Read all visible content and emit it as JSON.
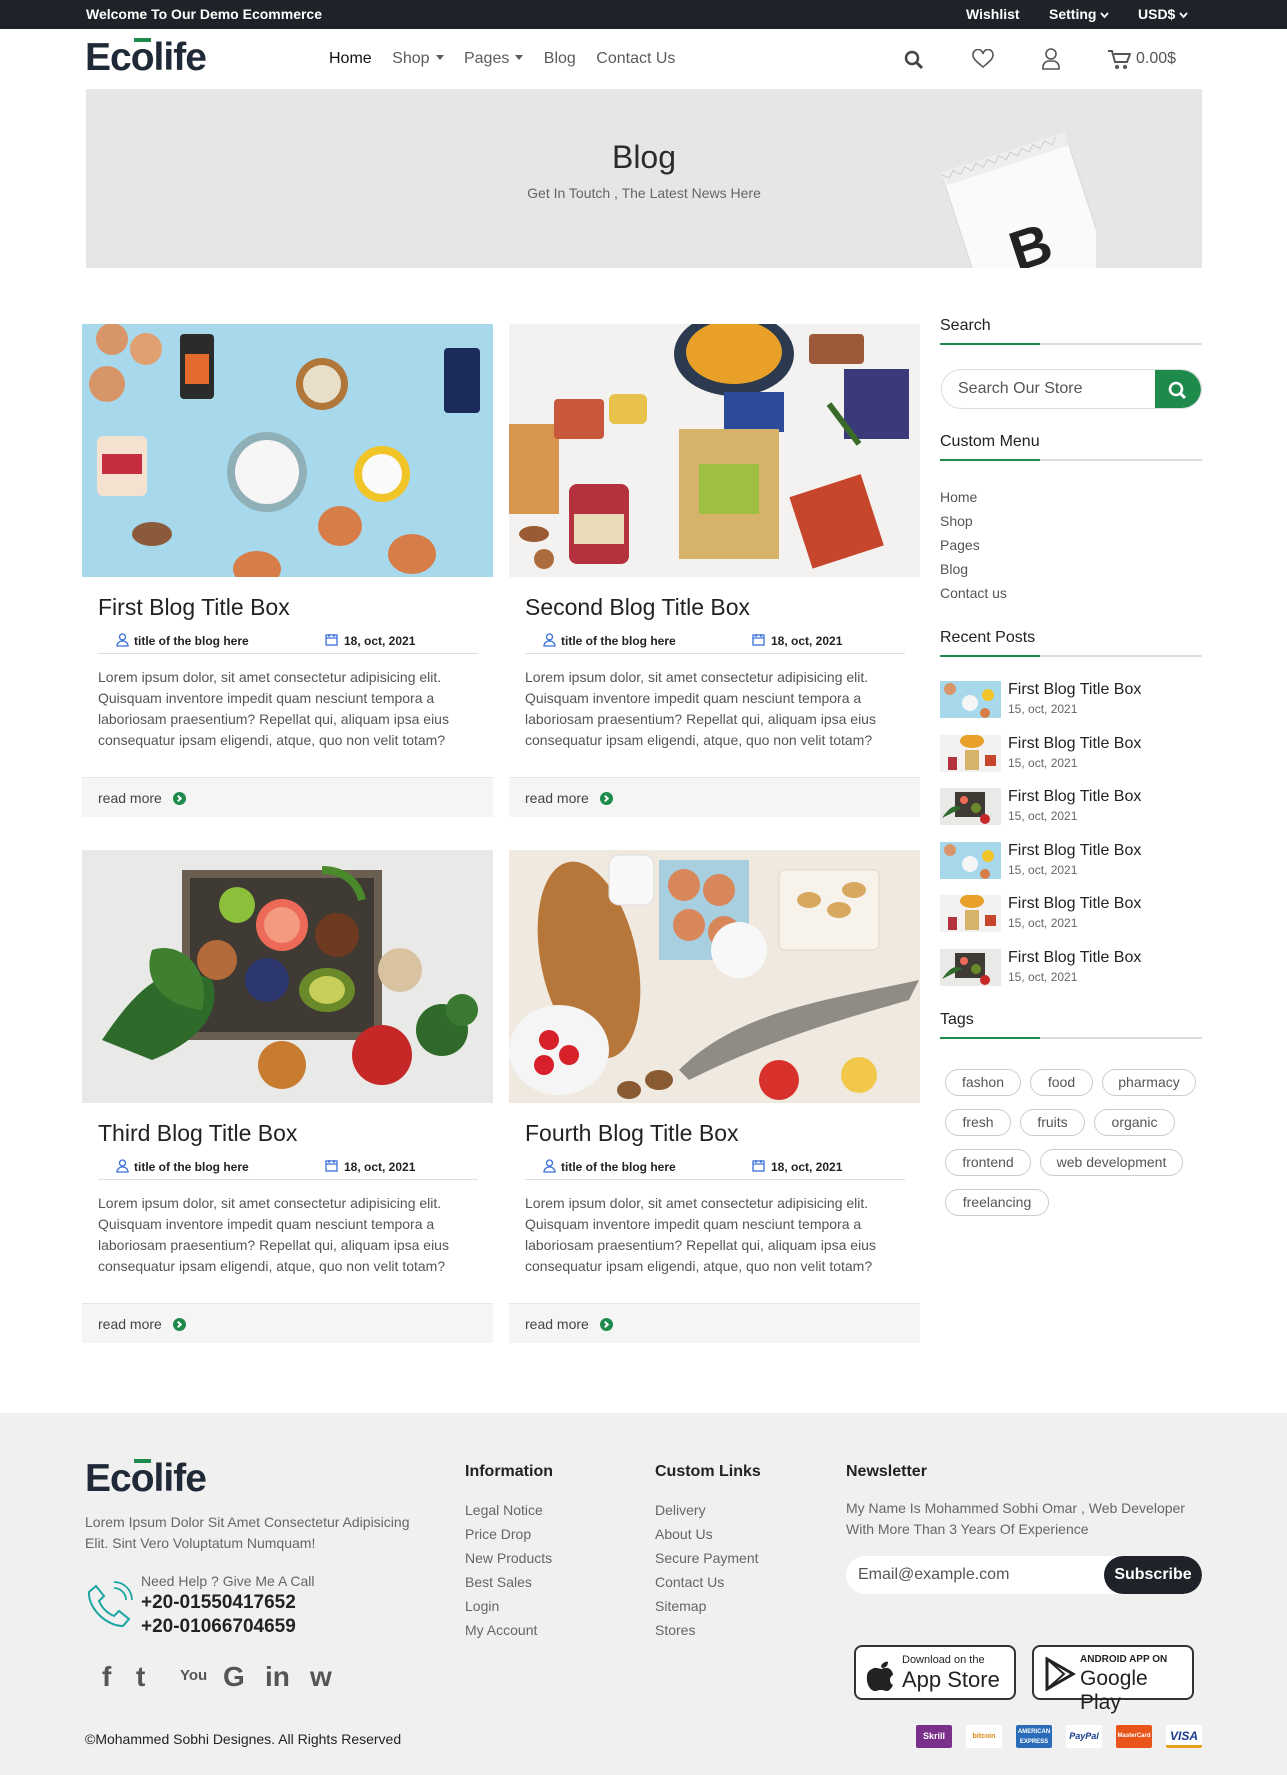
{
  "topbar": {
    "welcome": "Welcome To Our Demo Ecommerce",
    "wishlist": "Wishlist",
    "setting": "Setting",
    "currency": "USD$"
  },
  "header": {
    "logo": {
      "pre": "Ec",
      "o": "o",
      "post": "life"
    },
    "menu": [
      {
        "label": "Home",
        "active": true
      },
      {
        "label": "Shop",
        "caret": true
      },
      {
        "label": "Pages",
        "caret": true
      },
      {
        "label": "Blog"
      },
      {
        "label": "Contact Us"
      }
    ],
    "cart_total": "0.00$"
  },
  "banner": {
    "title": "Blog",
    "subtitle": "Get In Toutch , The Latest News Here"
  },
  "posts": [
    {
      "title": "First Blog Title Box",
      "author": "title of the blog here",
      "date": "18, oct, 2021",
      "excerpt": "Lorem ipsum dolor, sit amet consectetur adipisicing elit. Quisquam inventore impedit quam nesciunt tempora a laboriosam praesentium? Repellat qui, aliquam ipsa eius consequatur ipsam eligendi, atque, quo non velit totam?",
      "read_more": "read more"
    },
    {
      "title": "Second Blog Title Box",
      "author": "title of the blog here",
      "date": "18, oct, 2021",
      "excerpt": "Lorem ipsum dolor, sit amet consectetur adipisicing elit. Quisquam inventore impedit quam nesciunt tempora a laboriosam praesentium? Repellat qui, aliquam ipsa eius consequatur ipsam eligendi, atque, quo non velit totam?",
      "read_more": "read more"
    },
    {
      "title": "Third Blog Title Box",
      "author": "title of the blog here",
      "date": "18, oct, 2021",
      "excerpt": "Lorem ipsum dolor, sit amet consectetur adipisicing elit. Quisquam inventore impedit quam nesciunt tempora a laboriosam praesentium? Repellat qui, aliquam ipsa eius consequatur ipsam eligendi, atque, quo non velit totam?",
      "read_more": "read more"
    },
    {
      "title": "Fourth Blog Title Box",
      "author": "title of the blog here",
      "date": "18, oct, 2021",
      "excerpt": "Lorem ipsum dolor, sit amet consectetur adipisicing elit. Quisquam inventore impedit quam nesciunt tempora a laboriosam praesentium? Repellat qui, aliquam ipsa eius consequatur ipsam eligendi, atque, quo non velit totam?",
      "read_more": "read more"
    }
  ],
  "sidebar": {
    "search": {
      "heading": "Search",
      "placeholder": "Search Our Store"
    },
    "custom_menu": {
      "heading": "Custom Menu",
      "items": [
        "Home",
        "Shop",
        "Pages",
        "Blog",
        "Contact us"
      ]
    },
    "recent_posts": {
      "heading": "Recent Posts",
      "items": [
        {
          "title": "First Blog Title Box",
          "date": "15, oct, 2021"
        },
        {
          "title": "First Blog Title Box",
          "date": "15, oct, 2021"
        },
        {
          "title": "First Blog Title Box",
          "date": "15, oct, 2021"
        },
        {
          "title": "First Blog Title Box",
          "date": "15, oct, 2021"
        },
        {
          "title": "First Blog Title Box",
          "date": "15, oct, 2021"
        },
        {
          "title": "First Blog Title Box",
          "date": "15, oct, 2021"
        }
      ]
    },
    "tags": {
      "heading": "Tags",
      "items": [
        "fashon",
        "food",
        "pharmacy",
        "fresh",
        "fruits",
        "organic",
        "frontend",
        "web development",
        "freelancing"
      ]
    }
  },
  "footer": {
    "about": "Lorem Ipsum Dolor Sit Amet Consectetur Adipisicing Elit. Sint Vero Voluptatum Numquam!",
    "help_label": "Need Help ? Give Me A Call",
    "phones": [
      "+20-01550417652",
      "+20-01066704659"
    ],
    "social_icons": [
      "facebook-icon",
      "twitter-icon",
      "youtube-icon",
      "google-icon",
      "linkedin-icon",
      "whatsapp-icon"
    ],
    "social_glyphs": [
      "f",
      "t",
      "You",
      "G",
      "in",
      "w"
    ],
    "information": {
      "heading": "Information",
      "items": [
        "Legal Notice",
        "Price Drop",
        "New Products",
        "Best Sales",
        "Login",
        "My Account"
      ]
    },
    "custom_links": {
      "heading": "Custom Links",
      "items": [
        "Delivery",
        "About Us",
        "Secure Payment",
        "Contact Us",
        "Sitemap",
        "Stores"
      ]
    },
    "newsletter": {
      "heading": "Newsletter",
      "text": "My Name Is Mohammed Sobhi Omar , Web Developer With More Than 3 Years Of Experience",
      "placeholder": "Email@example.com",
      "button": "Subscribe"
    },
    "app_store": {
      "small": "Download on the",
      "big": "App Store"
    },
    "google_play": {
      "small": "ANDROID APP ON",
      "big": "Google Play"
    },
    "copyright": "©Mohammed Sobhi Designes. All Rights Reserved",
    "payments": [
      "Skrill",
      "bitcoin",
      "AMERICAN EXPRESS",
      "PayPal",
      "MasterCard",
      "VISA"
    ]
  },
  "colors": {
    "accent": "#1e8b4d",
    "dark": "#1f2329",
    "footer_bg": "#f0f0f0",
    "banner_bg": "#e4e7e6"
  }
}
